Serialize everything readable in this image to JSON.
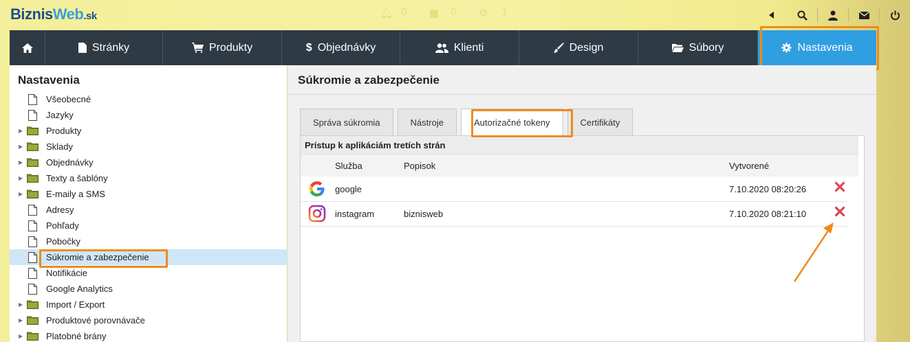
{
  "header": {
    "logo": {
      "part1": "Biznis",
      "part2": "Web",
      "part3": ".sk"
    },
    "faint_counts": [
      "0",
      "0",
      "1"
    ],
    "icons": [
      "play-left-icon",
      "search-icon",
      "user-icon",
      "mail-icon",
      "power-icon"
    ]
  },
  "nav": {
    "items": [
      {
        "label": "",
        "icon": "home-icon"
      },
      {
        "label": "Stránky",
        "icon": "page-icon"
      },
      {
        "label": "Produkty",
        "icon": "cart-icon"
      },
      {
        "label": "Objednávky",
        "icon": "dollar-icon"
      },
      {
        "label": "Klienti",
        "icon": "users-icon"
      },
      {
        "label": "Design",
        "icon": "brush-icon"
      },
      {
        "label": "Súbory",
        "icon": "folder-icon"
      },
      {
        "label": "Nastavenia",
        "icon": "gear-icon",
        "active": true
      }
    ]
  },
  "sidebar": {
    "title": "Nastavenia",
    "items": [
      {
        "label": "Všeobecné",
        "type": "page"
      },
      {
        "label": "Jazyky",
        "type": "page"
      },
      {
        "label": "Produkty",
        "type": "folder"
      },
      {
        "label": "Sklady",
        "type": "folder"
      },
      {
        "label": "Objednávky",
        "type": "folder"
      },
      {
        "label": "Texty a šablóny",
        "type": "folder"
      },
      {
        "label": "E-maily a SMS",
        "type": "folder"
      },
      {
        "label": "Adresy",
        "type": "page"
      },
      {
        "label": "Pohľady",
        "type": "page"
      },
      {
        "label": "Pobočky",
        "type": "page"
      },
      {
        "label": "Súkromie a zabezpečenie",
        "type": "page",
        "selected": true
      },
      {
        "label": "Notifikácie",
        "type": "page"
      },
      {
        "label": "Google Analytics",
        "type": "page"
      },
      {
        "label": "Import / Export",
        "type": "folder"
      },
      {
        "label": "Produktové porovnávače",
        "type": "folder"
      },
      {
        "label": "Platobné brány",
        "type": "folder"
      }
    ]
  },
  "main": {
    "title": "Súkromie a zabezpečenie",
    "tabs": [
      {
        "label": "Správa súkromia"
      },
      {
        "label": "Nástroje"
      },
      {
        "label": "Autorizačné tokeny",
        "active": true
      },
      {
        "label": "Certifikáty"
      }
    ],
    "panel_title": "Prístup k aplikáciám tretích strán",
    "columns": {
      "service": "Služba",
      "description": "Popisok",
      "created": "Vytvorené"
    },
    "rows": [
      {
        "icon": "google-icon",
        "service": "google",
        "description": "",
        "created": "7.10.2020 08:20:26"
      },
      {
        "icon": "instagram-icon",
        "service": "instagram",
        "description": "biznisweb",
        "created": "7.10.2020 08:21:10"
      }
    ]
  },
  "colors": {
    "nav_bg": "#2e3a44",
    "nav_active": "#2f9fe2",
    "highlight": "#f08a1c",
    "selected_row": "#cfe6f7",
    "delete": "#d9474f"
  }
}
